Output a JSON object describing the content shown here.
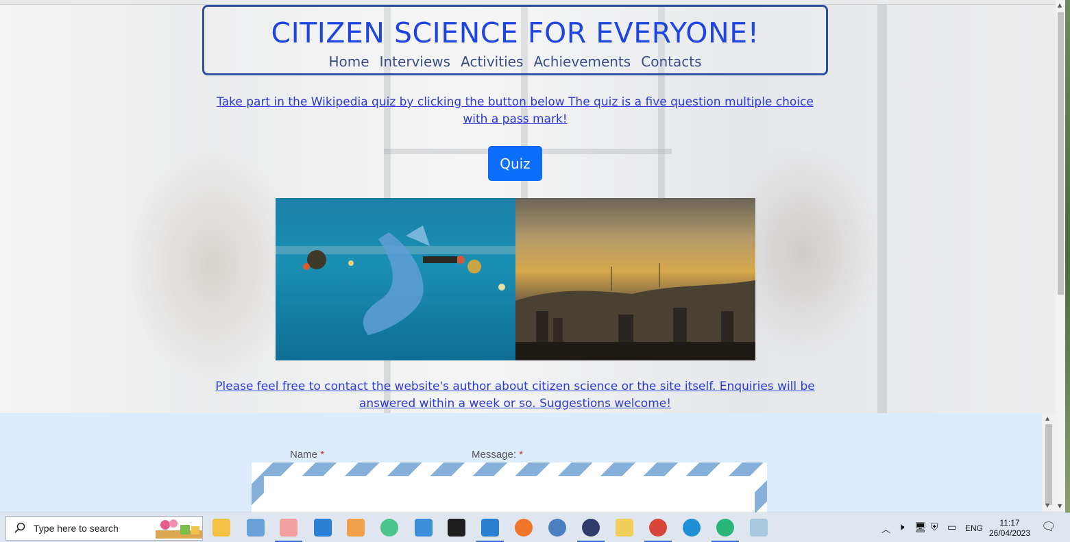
{
  "header": {
    "title": "CITIZEN SCIENCE FOR EVERYONE!",
    "nav": [
      "Home",
      "Interviews",
      "Activities",
      "Achievements",
      "Contacts"
    ]
  },
  "quiz": {
    "intro": "Take part in the Wikipedia quiz by clicking the button below The quiz is a five question multiple choice with a pass mark!",
    "button_label": "Quiz"
  },
  "images": [
    {
      "name": "ocean-plastic-image"
    },
    {
      "name": "city-sunset-image"
    }
  ],
  "contact": {
    "text": "Please feel free to contact the website's author about citizen science or the site itself. Enquiries will be answered within a week or so. Suggestions welcome!"
  },
  "form": {
    "name_label": "Name",
    "message_label": "Message:",
    "required_mark": "*"
  },
  "taskbar": {
    "search_placeholder": "Type here to search",
    "language": "ENG",
    "time": "11:17",
    "date": "26/04/2023"
  },
  "colors": {
    "title": "#1f45e0",
    "nav": "#3a4d86",
    "link": "#2d3bd8",
    "button": "#0d6efd",
    "form_section": "#dcebfd",
    "envelope_stripe": "#86b0d9"
  }
}
